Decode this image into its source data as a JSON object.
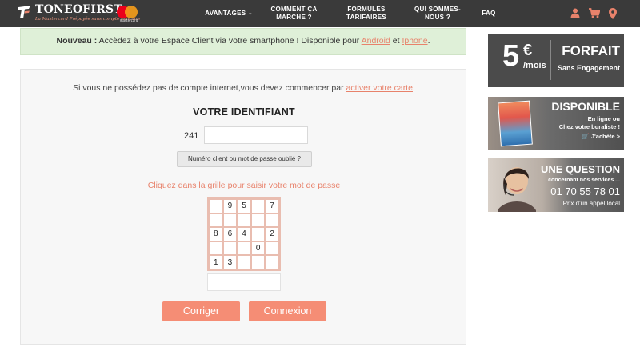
{
  "header": {
    "logo_text": "TONEOFIRST",
    "logo_tagline": "La Mastercard Prépayée sans compte bancaire",
    "mastercard_label": "mastercard",
    "nav": [
      {
        "label": "AVANTAGES",
        "has_dropdown": true
      },
      {
        "label": "COMMENT ÇA MARCHE ?"
      },
      {
        "label": "FORMULES TARIFAIRES"
      },
      {
        "label": "QUI SOMMES-NOUS ?"
      },
      {
        "label": "FAQ"
      }
    ],
    "icons": [
      "user-icon",
      "cart-icon",
      "map-marker-icon"
    ],
    "accent_color": "#e8826b"
  },
  "banner": {
    "bold": "Nouveau :",
    "text": "Accèdez à votre Espace Client via votre smartphone ! Disponible pour",
    "link_android": "Android",
    "and": "et",
    "link_iphone": "Iphone",
    "end": "."
  },
  "login": {
    "intro": "Si vous ne possédez pas de compte internet,vous devez commencer par",
    "intro_link": "activer votre carte",
    "intro_end": ".",
    "title": "VOTRE IDENTIFIANT",
    "id_prefix": "241",
    "id_value": "",
    "forgot_label": "Numéro client ou mot de passe oublié ?",
    "grid_hint": "Cliquez dans la grille pour saisir votre mot de passe",
    "grid": [
      [
        "",
        "9",
        "5",
        "",
        "7"
      ],
      [
        "",
        "",
        "",
        "",
        ""
      ],
      [
        "8",
        "6",
        "4",
        "",
        "2"
      ],
      [
        "",
        "",
        "",
        "0",
        ""
      ],
      [
        "1",
        "3",
        "",
        "",
        ""
      ]
    ],
    "password_value": "",
    "reset_label": "Corriger",
    "submit_label": "Connexion",
    "button_color": "#f58d75"
  },
  "ads": {
    "forfait": {
      "price": "5",
      "currency": "€",
      "unit": "/mois",
      "title": "FORFAIT",
      "subtitle": "Sans Engagement"
    },
    "disponible": {
      "title": "DISPONIBLE",
      "line1": "En ligne ou",
      "line2": "Chez votre buraliste !",
      "cta": "J'achète >",
      "cta_icon": "cart-icon"
    },
    "question": {
      "title": "UNE QUESTION",
      "line1": "concernant nos services ...",
      "phone": "01 70 55 78 01",
      "note": "Prix d'un appel local"
    }
  }
}
